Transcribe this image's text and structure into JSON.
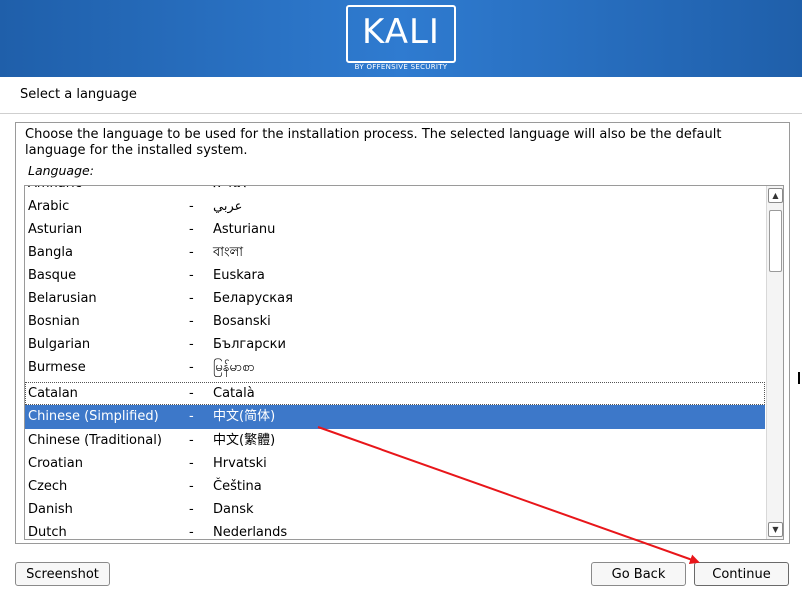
{
  "brand": {
    "logo_text": "KALI",
    "logo_subtitle": "BY OFFENSIVE SECURITY"
  },
  "page": {
    "title": "Select a language",
    "description": "Choose the language to be used for the installation process. The selected language will also be the default language for the installed system.",
    "list_label": "Language:"
  },
  "languages": [
    {
      "name": "Amharic",
      "native": "አማርኛ"
    },
    {
      "name": "Arabic",
      "native": "عربي"
    },
    {
      "name": "Asturian",
      "native": "Asturianu"
    },
    {
      "name": "Bangla",
      "native": "বাংলা"
    },
    {
      "name": "Basque",
      "native": "Euskara"
    },
    {
      "name": "Belarusian",
      "native": "Беларуская"
    },
    {
      "name": "Bosnian",
      "native": "Bosanski"
    },
    {
      "name": "Bulgarian",
      "native": "Български"
    },
    {
      "name": "Burmese",
      "native": "မြန်မာစာ"
    },
    {
      "name": "Catalan",
      "native": "Català"
    },
    {
      "name": "Chinese (Simplified)",
      "native": "中文(简体)"
    },
    {
      "name": "Chinese (Traditional)",
      "native": "中文(繁體)"
    },
    {
      "name": "Croatian",
      "native": "Hrvatski"
    },
    {
      "name": "Czech",
      "native": "Čeština"
    },
    {
      "name": "Danish",
      "native": "Dansk"
    },
    {
      "name": "Dutch",
      "native": "Nederlands"
    }
  ],
  "separator": "-",
  "selected_language": "Chinese (Simplified)",
  "buttons": {
    "screenshot": "Screenshot",
    "go_back": "Go Back",
    "continue": "Continue"
  },
  "colors": {
    "banner": "#2f7bd0",
    "selection": "#3d78c9",
    "annotation_arrow": "#e8161a"
  }
}
